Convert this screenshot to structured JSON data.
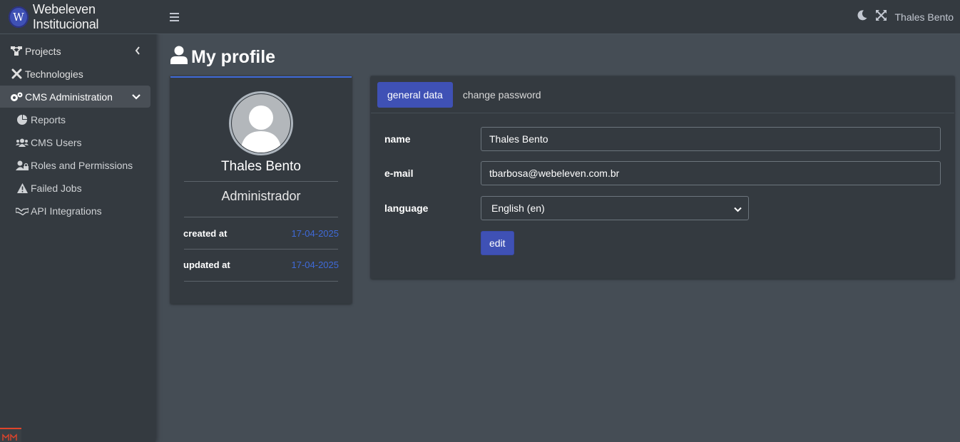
{
  "brand": {
    "logo_letter": "W",
    "name": "Webeleven Institucional"
  },
  "sidebar": {
    "items": [
      {
        "label": "Projects",
        "icon": "sitemap-icon"
      },
      {
        "label": "Technologies",
        "icon": "tools-icon"
      },
      {
        "label": "CMS Administration",
        "icon": "cogs-icon"
      }
    ],
    "sub_items": [
      {
        "label": "Reports",
        "icon": "chart-pie-icon"
      },
      {
        "label": "CMS Users",
        "icon": "users-icon"
      },
      {
        "label": "Roles and Permissions",
        "icon": "user-lock-icon"
      },
      {
        "label": "Failed Jobs",
        "icon": "warning-icon"
      },
      {
        "label": "API Integrations",
        "icon": "handshake-icon"
      }
    ]
  },
  "topbar": {
    "user_name": "Thales Bento"
  },
  "page": {
    "title": "My profile"
  },
  "profile": {
    "name": "Thales Bento",
    "role": "Administrador",
    "created_label": "created at",
    "created_value": "17-04-2025",
    "updated_label": "updated at",
    "updated_value": "17-04-2025"
  },
  "tabs": {
    "general": "general data",
    "password": "change password"
  },
  "form": {
    "name_label": "name",
    "name_value": "Thales Bento",
    "email_label": "e-mail",
    "email_value": "tbarbosa@webeleven.com.br",
    "language_label": "language",
    "language_value": "English (en)",
    "edit_label": "edit"
  },
  "colors": {
    "accent": "#3f51b5",
    "link": "#3f6ad8",
    "sidebar": "#343a40",
    "content": "#454d55"
  }
}
